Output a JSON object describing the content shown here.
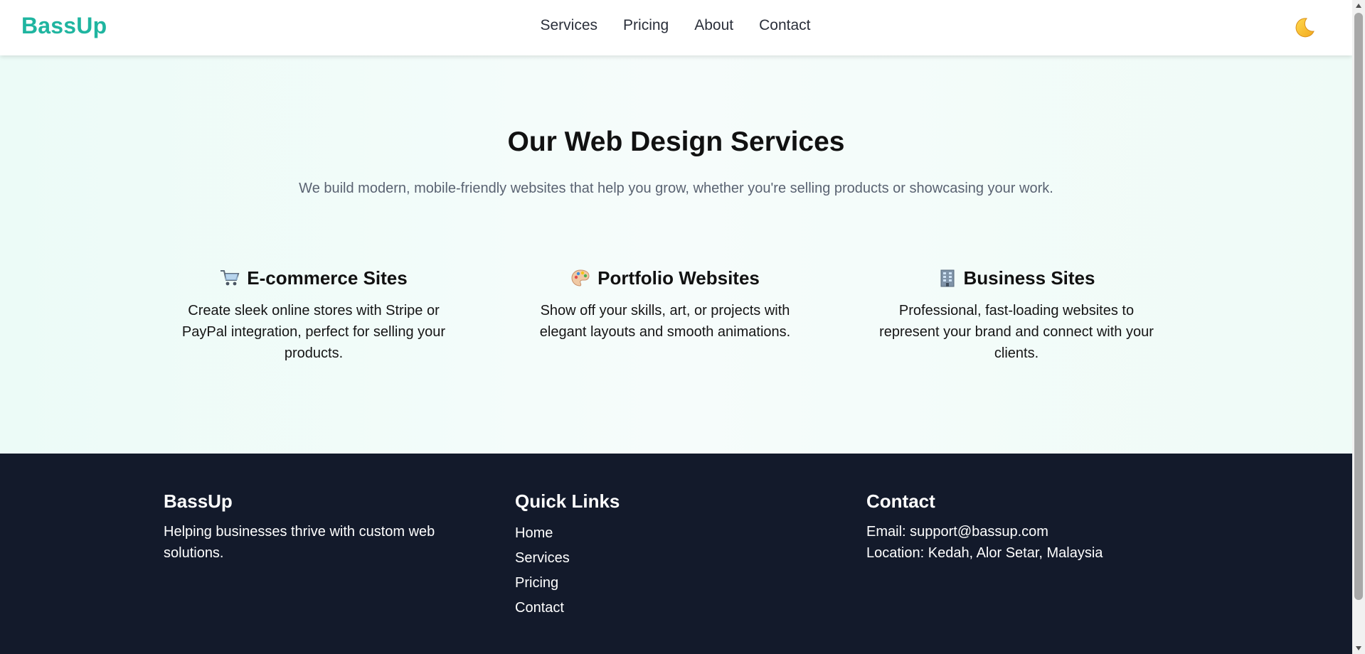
{
  "header": {
    "brand": "BassUp",
    "nav": [
      "Services",
      "Pricing",
      "About",
      "Contact"
    ],
    "theme_toggle_icon": "moon-icon"
  },
  "services": {
    "title": "Our Web Design Services",
    "subtitle": "We build modern, mobile-friendly websites that help you grow, whether you're selling products or showcasing your work.",
    "cards": [
      {
        "icon": "shopping-cart-icon",
        "title": "E-commerce Sites",
        "text": "Create sleek online stores with Stripe or PayPal integration, perfect for selling your products."
      },
      {
        "icon": "palette-icon",
        "title": "Portfolio Websites",
        "text": "Show off your skills, art, or projects with elegant layouts and smooth animations."
      },
      {
        "icon": "office-building-icon",
        "title": "Business Sites",
        "text": "Professional, fast-loading websites to represent your brand and connect with your clients."
      }
    ]
  },
  "footer": {
    "about": {
      "heading": "BassUp",
      "text": "Helping businesses thrive with custom web solutions."
    },
    "quick_links": {
      "heading": "Quick Links",
      "links": [
        "Home",
        "Services",
        "Pricing",
        "Contact"
      ]
    },
    "contact": {
      "heading": "Contact",
      "email": "Email: support@bassup.com",
      "location": "Location: Kedah, Alor Setar, Malaysia"
    }
  },
  "colors": {
    "brand": "#1fb5a0",
    "footer_bg": "#131a2b",
    "hero_bg": "#ecfbf7"
  }
}
